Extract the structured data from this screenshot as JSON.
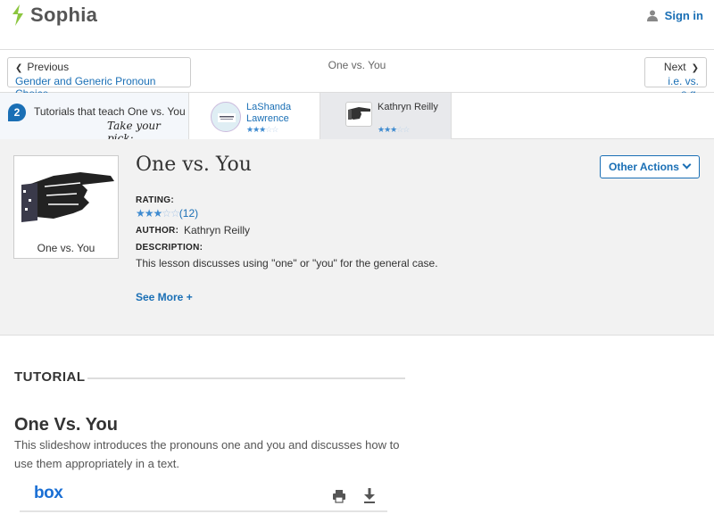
{
  "header": {
    "brand": "Sophia",
    "signin_label": "Sign in",
    "icons": {
      "logo": "sophia-logo-icon",
      "user": "user-icon"
    }
  },
  "nav": {
    "prev_label": "Previous",
    "prev_title": "Gender and Generic Pronoun Choice",
    "current_title": "One vs. You",
    "next_label": "Next",
    "next_title": "i.e. vs. e.g."
  },
  "tutorials_strip": {
    "count": "2",
    "count_text": "Tutorials that teach One vs. You",
    "pick_text": "Take your pick:",
    "cards": [
      {
        "name": "LaShanda Lawrence",
        "rating": 3,
        "max": 5
      },
      {
        "name": "Kathryn Reilly",
        "rating": 3,
        "max": 5
      }
    ]
  },
  "lesson": {
    "title": "One vs. You",
    "thumb_caption": "One vs. You",
    "rating_label": "RATING:",
    "rating_stars": 3,
    "rating_count": "(12)",
    "author_label": "AUTHOR:",
    "author": "Kathryn Reilly",
    "description_label": "DESCRIPTION:",
    "description": "This lesson discusses using \"one\" or \"you\" for the general case.",
    "see_more": "See More +",
    "other_actions": "Other Actions"
  },
  "tutorial": {
    "section_label": "TUTORIAL",
    "title": "One Vs. You",
    "description": "This slideshow introduces the pronouns one and you and discusses how to use them appropriately in a text.",
    "viewer_brand": "box",
    "icons": {
      "print": "print-icon",
      "download": "download-icon"
    }
  },
  "colors": {
    "accent": "#1a6fb5",
    "brand_green": "#8cc63f",
    "panel_bg": "#f2f2f2"
  }
}
